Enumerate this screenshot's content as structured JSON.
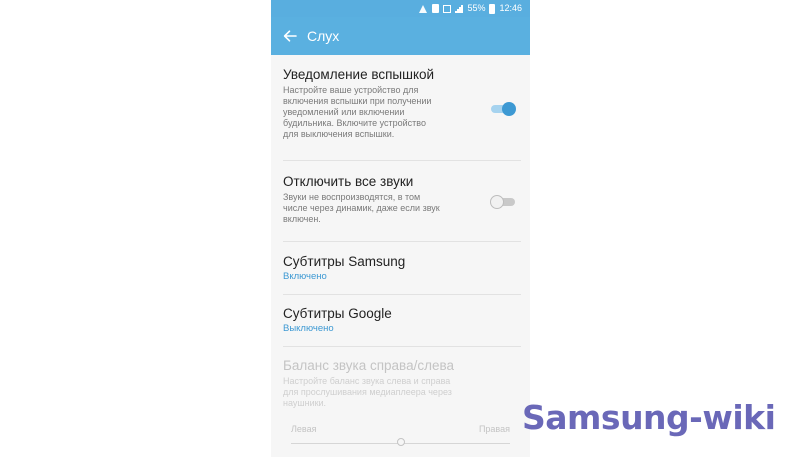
{
  "status_bar": {
    "battery": "55%",
    "time": "12:46"
  },
  "app_bar": {
    "title": "Слух"
  },
  "settings": {
    "flash_notification": {
      "title": "Уведомление вспышкой",
      "description_lines": [
        "Настройте ваше устройство для",
        "включения вспышки при получении",
        "уведомлений или включении",
        "будильника. Включите устройство",
        "для выключения вспышки."
      ],
      "enabled": true
    },
    "mute_all": {
      "title": "Отключить все звуки",
      "description_lines": [
        "Звуки не воспроизводятся, в том",
        "числе через динамик, даже если звук",
        "включен."
      ],
      "enabled": false
    },
    "samsung_subtitles": {
      "title": "Субтитры Samsung",
      "status": "Включено"
    },
    "google_subtitles": {
      "title": "Субтитры Google",
      "status": "Выключено"
    },
    "sound_balance": {
      "title": "Баланс звука справа/слева",
      "description_lines": [
        "Настройте баланс звука слева и справа",
        "для прослушивания медиаплеера через",
        "наушники."
      ],
      "left_label": "Левая",
      "right_label": "Правая",
      "value": 0.5
    }
  },
  "watermark": "Samsung-wiki",
  "colors": {
    "accent": "#3d99d3",
    "app_bar": "#5ab0e0",
    "watermark": "#6a68b8"
  }
}
